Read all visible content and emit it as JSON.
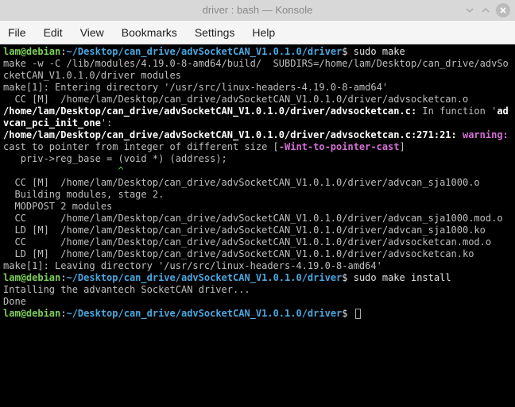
{
  "titlebar": {
    "title": "driver : bash — Konsole"
  },
  "menubar": {
    "items": [
      "File",
      "Edit",
      "View",
      "Bookmarks",
      "Settings",
      "Help"
    ]
  },
  "prompt": {
    "userhost": "lam@debian",
    "colon": ":",
    "path": "~/Desktop/can_drive/advSocketCAN_V1.0.1.0/driver",
    "dollar": "$ "
  },
  "cmds": {
    "sudo_make": "sudo make",
    "sudo_make_install": "sudo make install"
  },
  "lines": {
    "l1": "make -w -C /lib/modules/4.19.0-8-amd64/build/  SUBDIRS=/home/lam/Desktop/can_drive/advSocketCAN_V1.0.1.0/driver modules",
    "l2": "make[1]: Entering directory '/usr/src/linux-headers-4.19.0-8-amd64'",
    "l3": "  CC [M]  /home/lam/Desktop/can_drive/advSocketCAN_V1.0.1.0/driver/advsocketcan.o",
    "l4a": "/home/lam/Desktop/can_drive/advSocketCAN_V1.0.1.0/driver/advsocketcan.c:",
    "l4b": " In function '",
    "l4c": "advcan_pci_init_one",
    "l4d": "':",
    "l5a": "/home/lam/Desktop/can_drive/advSocketCAN_V1.0.1.0/driver/advsocketcan.c:271:21:",
    "l5b": " warning:",
    "l5c": " cast to pointer from integer of different size [",
    "l5d": "-Wint-to-pointer-cast",
    "l5e": "]",
    "l6": "   priv->reg_base = (void *) (address);",
    "l7": "                    ^",
    "l8": "  CC [M]  /home/lam/Desktop/can_drive/advSocketCAN_V1.0.1.0/driver/advcan_sja1000.o",
    "l9": "  Building modules, stage 2.",
    "l10": "  MODPOST 2 modules",
    "l11": "  CC      /home/lam/Desktop/can_drive/advSocketCAN_V1.0.1.0/driver/advcan_sja1000.mod.o",
    "l12": "  LD [M]  /home/lam/Desktop/can_drive/advSocketCAN_V1.0.1.0/driver/advcan_sja1000.ko",
    "l13": "  CC      /home/lam/Desktop/can_drive/advSocketCAN_V1.0.1.0/driver/advsocketcan.mod.o",
    "l14": "  LD [M]  /home/lam/Desktop/can_drive/advSocketCAN_V1.0.1.0/driver/advsocketcan.ko",
    "l15": "make[1]: Leaving directory '/usr/src/linux-headers-4.19.0-8-amd64'",
    "l16": "Intalling the advantech SocketCAN driver...",
    "l17": "Done"
  }
}
